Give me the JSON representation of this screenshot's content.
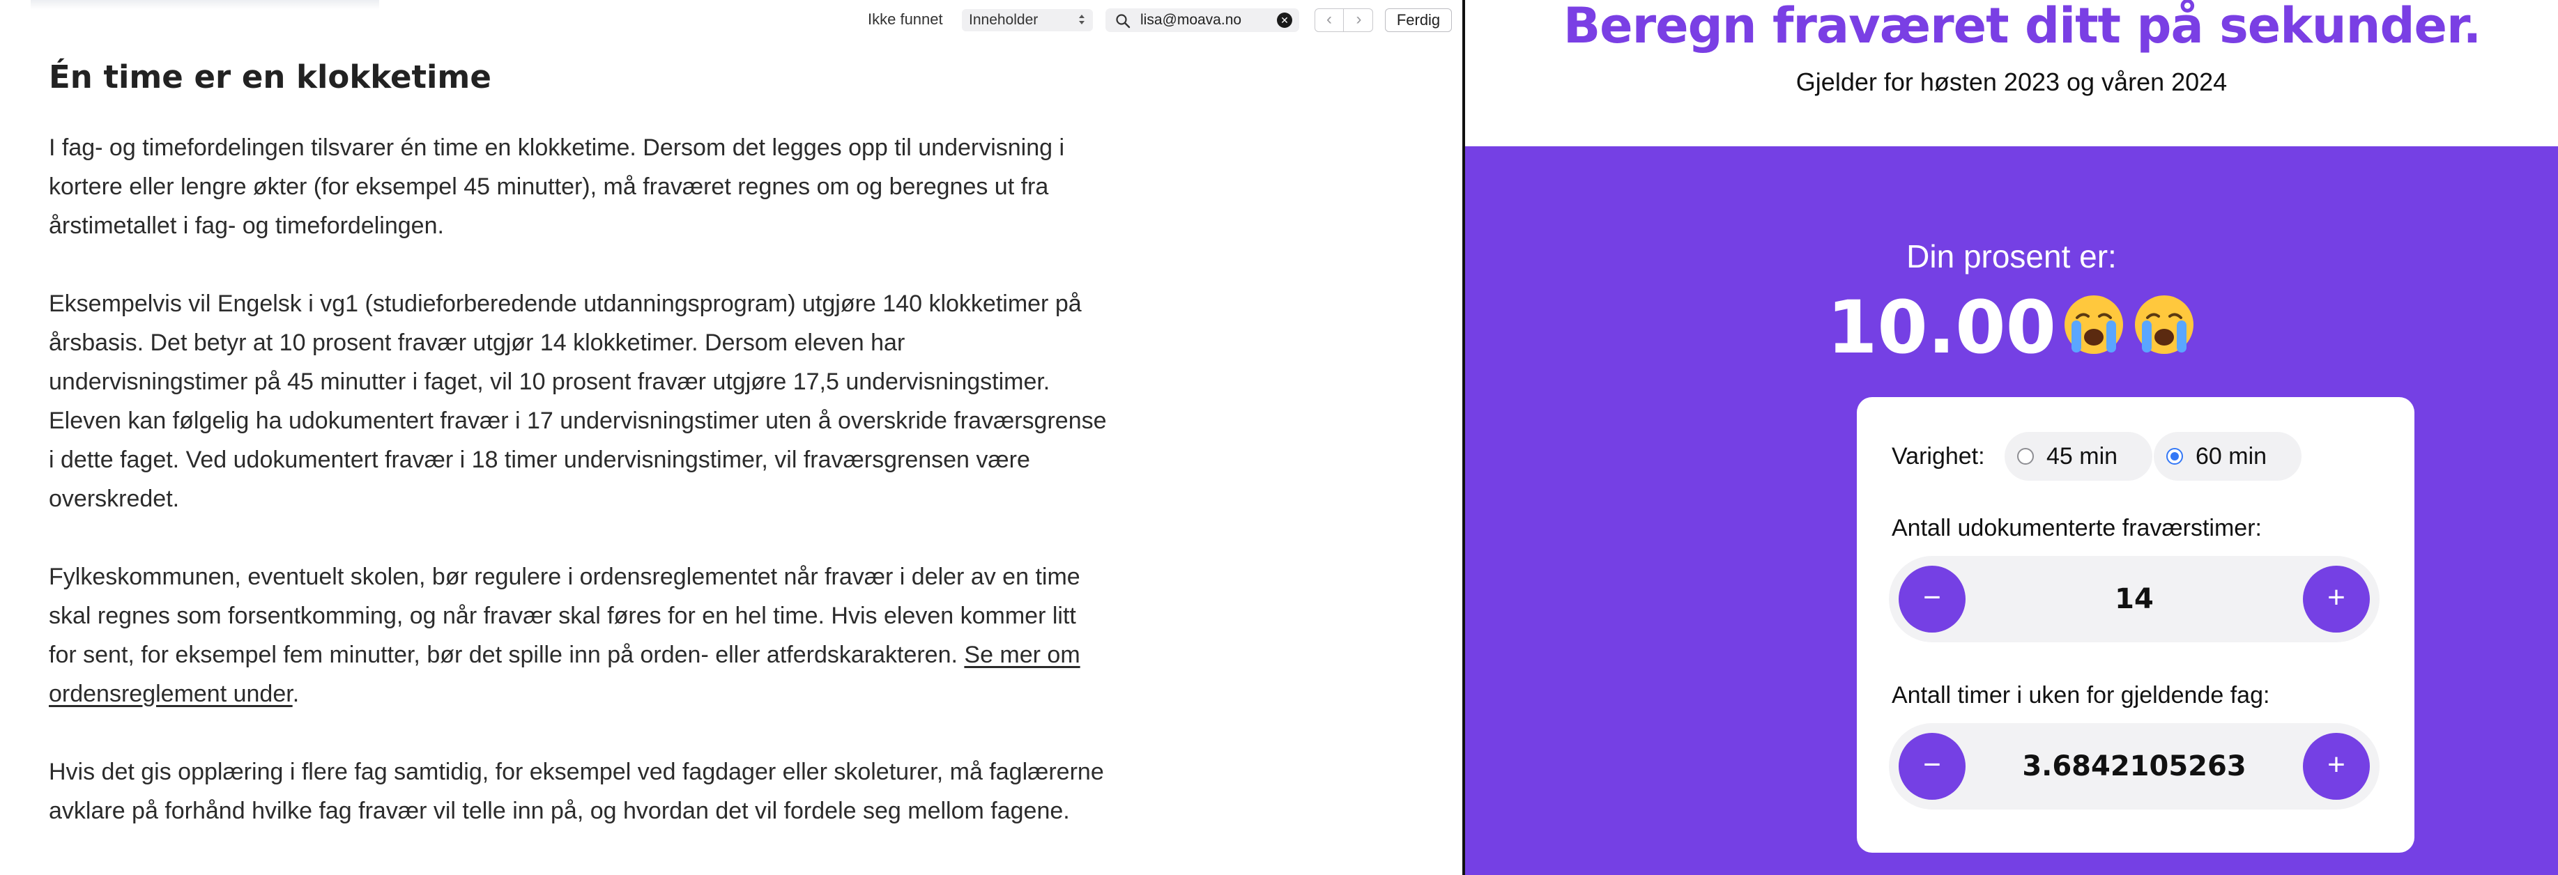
{
  "findbar": {
    "status": "Ikke funnet",
    "mode": "Inneholder",
    "query": "lisa@moava.no",
    "prev_label": "‹",
    "next_label": "›",
    "done_label": "Ferdig"
  },
  "article": {
    "heading": "Én time er en klokketime",
    "p1": "I fag- og timefordelingen tilsvarer én time en klokketime. Dersom det legges opp til undervisning i kortere eller lengre økter (for eksempel 45 minutter), må fraværet regnes om og beregnes ut fra årstimetallet i fag- og timefordelingen.",
    "p2": "Eksempelvis vil Engelsk i vg1 (studieforberedende utdanningsprogram) utgjøre 140 klokketimer på årsbasis. Det betyr at 10 prosent fravær utgjør 14 klokketimer. Dersom eleven har undervisningstimer på 45 minutter i faget, vil 10 prosent fravær utgjøre 17,5 undervisningstimer. Eleven kan følgelig ha udokumentert fravær i 17 undervisningstimer uten å overskride fraværsgrense i dette faget. Ved udokumentert fravær i 18 timer undervisningstimer, vil fraværsgrensen være overskredet.",
    "p3_text": "Fylkeskommunen, eventuelt skolen, bør regulere i ordensreglementet når fravær i deler av en time skal regnes som forsentkomming, og når fravær skal føres for en hel time. Hvis eleven kommer litt for sent, for eksempel fem minutter, bør det spille inn på orden- eller atferdskarakteren. ",
    "p3_link": "Se mer om ordensreglement under",
    "p3_end": ".",
    "p4": "Hvis det gis opplæring i flere fag samtidig, for eksempel ved fagdager eller skoleturer, må faglærerne avklare på forhånd hvilke fag fravær vil telle inn på, og hvordan det vil fordele seg mellom fagene."
  },
  "calculator": {
    "title": "Beregn fraværet ditt på sekunder.",
    "subtitle": "Gjelder for høsten 2023 og våren 2024",
    "result_label": "Din prosent er:",
    "result_value": "10.00",
    "result_emoji": "loudly-crying-face",
    "duration_label": "Varighet:",
    "duration_options": [
      "45 min",
      "60 min"
    ],
    "duration_selected": "60 min",
    "absence_label": "Antall udokumenterte fraværstimer:",
    "absence_value": "14",
    "weekly_label": "Antall timer i uken for gjeldende fag:",
    "weekly_value": "3.6842105263",
    "minus_label": "−",
    "plus_label": "+"
  },
  "colors": {
    "brand_purple": "#7540e4",
    "title_purple": "#7a3fe4",
    "radio_blue": "#3478f6"
  }
}
